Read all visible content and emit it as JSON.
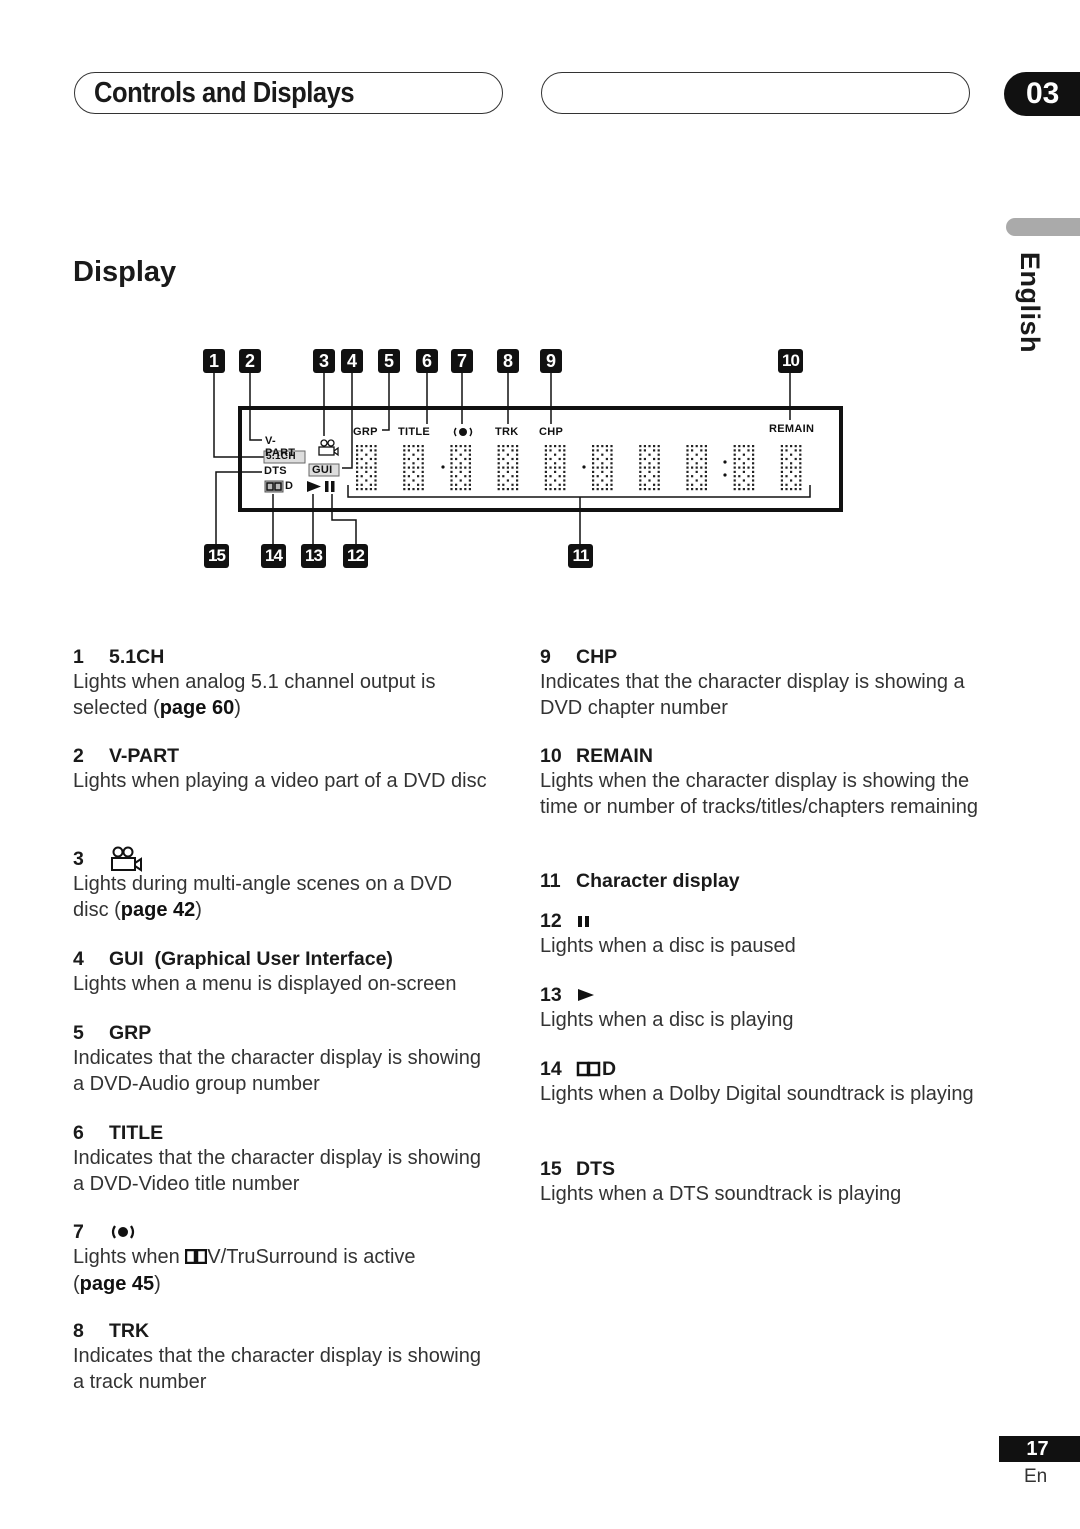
{
  "header": {
    "section_title": "Controls and Displays",
    "right_pill_text": "",
    "chapter_number": "03"
  },
  "language_tab": {
    "label": "English"
  },
  "page_title": "Display",
  "diagram": {
    "top_callouts": [
      "1",
      "2",
      "3",
      "4",
      "5",
      "6",
      "7",
      "8",
      "9",
      "10"
    ],
    "bottom_callouts": [
      "15",
      "14",
      "13",
      "12",
      "11"
    ],
    "lcd_labels": {
      "v_part": "V-PART",
      "ch51": "5.1CH",
      "dts": "DTS",
      "gui": "GUI",
      "dolby_d": "D",
      "grp": "GRP",
      "title": "TITLE",
      "trk": "TRK",
      "chp": "CHP",
      "remain": "REMAIN"
    },
    "character_cells": 10
  },
  "items_left": [
    {
      "num": "1",
      "name": "5.1CH",
      "desc": "Lights when analog 5.1 channel output is selected (",
      "page": "page 60",
      "tail": ")"
    },
    {
      "num": "2",
      "name": "V-PART",
      "desc": "Lights when playing a video part of a DVD disc"
    },
    {
      "num": "3",
      "icon": "camera-angle-icon",
      "desc": "Lights during multi-angle scenes on a DVD disc (",
      "page": "page 42",
      "tail": ")"
    },
    {
      "num": "4",
      "name": "GUI  (Graphical User Interface)",
      "desc": "Lights when a menu is displayed on-screen"
    },
    {
      "num": "5",
      "name": "GRP",
      "desc": "Indicates that the character display is showing a DVD-Audio group number"
    },
    {
      "num": "6",
      "name": "TITLE",
      "desc": "Indicates that the character display is showing a DVD-Video title number"
    },
    {
      "num": "7",
      "icon": "surround-icon",
      "desc_pre": "Lights when ",
      "desc_post": "V/TruSurround is active",
      "page_pre": "(",
      "page": "page 45",
      "tail": ")"
    },
    {
      "num": "8",
      "name": "TRK",
      "desc": "Indicates that the character display is showing a track number"
    }
  ],
  "items_right": [
    {
      "num": "9",
      "name": "CHP",
      "desc": "Indicates that the character display is showing a DVD chapter number"
    },
    {
      "num": "10",
      "name": "REMAIN",
      "desc": "Lights when the character display is showing the time or number of tracks/titles/chapters remaining"
    },
    {
      "num": "11",
      "name": "Character display"
    },
    {
      "num": "12",
      "icon": "pause-icon",
      "desc": "Lights when a disc is paused"
    },
    {
      "num": "13",
      "icon": "play-icon",
      "desc": "Lights when a disc is playing"
    },
    {
      "num": "14",
      "icon": "dolby-digital-icon",
      "name": "D",
      "desc": "Lights when a Dolby Digital soundtrack is playing"
    },
    {
      "num": "15",
      "name": "DTS",
      "desc": "Lights when a DTS soundtrack is playing"
    }
  ],
  "footer": {
    "page_number": "17",
    "language_code": "En"
  }
}
